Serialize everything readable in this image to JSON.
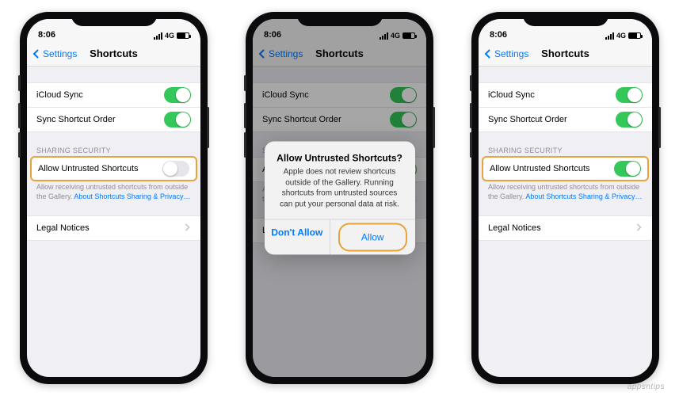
{
  "status": {
    "time": "8:06",
    "network": "4G"
  },
  "nav": {
    "back": "Settings",
    "title": "Shortcuts"
  },
  "rows": {
    "icloud": "iCloud Sync",
    "order": "Sync Shortcut Order",
    "allow": "Allow Untrusted Shortcuts",
    "legal": "Legal Notices"
  },
  "section": {
    "sharing": "SHARING SECURITY"
  },
  "footer": {
    "text": "Allow receiving untrusted shortcuts from outside the Gallery.",
    "link": "About Shortcuts Sharing & Privacy…"
  },
  "alert": {
    "title": "Allow Untrusted Shortcuts?",
    "msg": "Apple does not review shortcuts outside of the Gallery. Running shortcuts from untrusted sources can put your personal data at risk.",
    "deny": "Don't Allow",
    "allow": "Allow"
  },
  "toggles": {
    "p1": {
      "icloud": true,
      "order": true,
      "allow": false
    },
    "p2": {
      "icloud": true,
      "order": true,
      "allow": true
    },
    "p3": {
      "icloud": true,
      "order": true,
      "allow": true
    }
  },
  "watermark": "appsntips"
}
